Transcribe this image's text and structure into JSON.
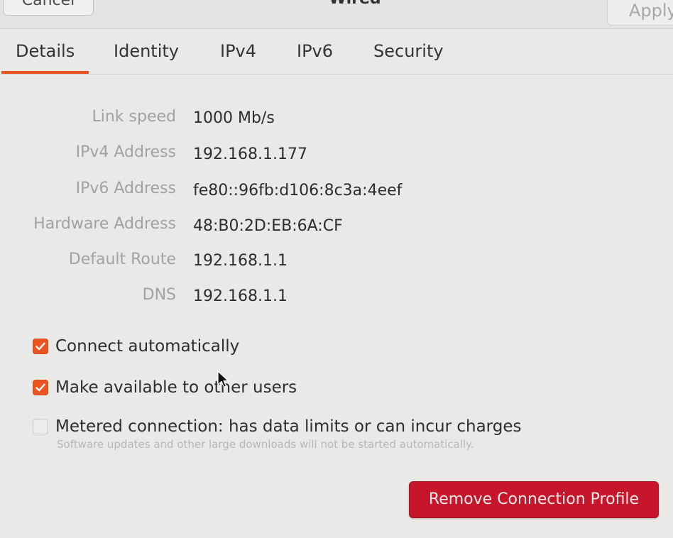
{
  "header": {
    "cancel_label": "Cancel",
    "title": "Wired",
    "apply_label": "Apply"
  },
  "tabs": [
    {
      "label": "Details",
      "active": true
    },
    {
      "label": "Identity",
      "active": false
    },
    {
      "label": "IPv4",
      "active": false
    },
    {
      "label": "IPv6",
      "active": false
    },
    {
      "label": "Security",
      "active": false
    }
  ],
  "details": [
    {
      "label": "Link speed",
      "value": "1000 Mb/s"
    },
    {
      "label": "IPv4 Address",
      "value": "192.168.1.177"
    },
    {
      "label": "IPv6 Address",
      "value": "fe80::96fb:d106:8c3a:4eef"
    },
    {
      "label": "Hardware Address",
      "value": "48:B0:2D:EB:6A:CF"
    },
    {
      "label": "Default Route",
      "value": "192.168.1.1"
    },
    {
      "label": "DNS",
      "value": "192.168.1.1"
    }
  ],
  "options": {
    "connect_automatically": {
      "label": "Connect automatically",
      "checked": true
    },
    "available_to_others": {
      "label": "Make available to other users",
      "checked": true
    },
    "metered": {
      "label": "Metered connection: has data limits or can incur charges",
      "sublabel": "Software updates and other large downloads will not be started automatically.",
      "checked": false
    }
  },
  "remove_button_label": "Remove Connection Profile",
  "colors": {
    "accent": "#e95420",
    "destructive": "#c7162b"
  }
}
